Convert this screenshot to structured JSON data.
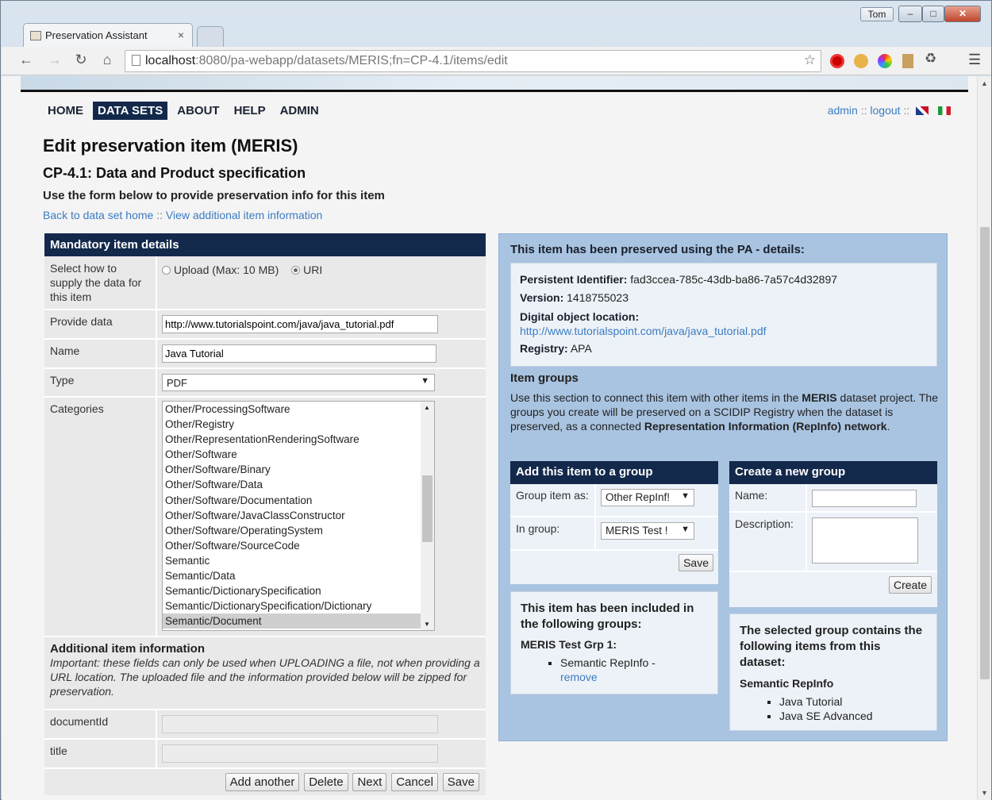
{
  "browser": {
    "tab_title": "Preservation Assistant",
    "url_host": "localhost",
    "url_rest": ":8080/pa-webapp/datasets/MERIS;fn=CP-4.1/items/edit",
    "user_badge": "Tom"
  },
  "nav": {
    "items": [
      "HOME",
      "DATA SETS",
      "ABOUT",
      "HELP",
      "ADMIN"
    ],
    "active": "DATA SETS",
    "admin_link": "admin",
    "logout_link": "logout",
    "sep": "::"
  },
  "page": {
    "title": "Edit preservation item (MERIS)",
    "subtitle": "CP-4.1: Data and Product specification",
    "instruction": "Use the form below to provide preservation info for this item",
    "back_link": "Back to data set home",
    "link_sep": "::",
    "view_link": "View additional item information"
  },
  "form": {
    "header": "Mandatory item details",
    "supply_label": "Select how to supply the data for this item",
    "upload_option": "Upload (Max: 10 MB)",
    "uri_option": "URI",
    "provide_label": "Provide data",
    "provide_value": "http://www.tutorialspoint.com/java/java_tutorial.pdf",
    "name_label": "Name",
    "name_value": "Java Tutorial",
    "type_label": "Type",
    "type_value": "PDF",
    "categories_label": "Categories",
    "categories": [
      "Other/ProcessingSoftware",
      "Other/Registry",
      "Other/RepresentationRenderingSoftware",
      "Other/Software",
      "Other/Software/Binary",
      "Other/Software/Data",
      "Other/Software/Documentation",
      "Other/Software/JavaClassConstructor",
      "Other/Software/OperatingSystem",
      "Other/Software/SourceCode",
      "Semantic",
      "Semantic/Data",
      "Semantic/DictionarySpecification",
      "Semantic/DictionarySpecification/Dictionary",
      "Semantic/Document"
    ],
    "selected_category": "Semantic/Document",
    "additional_title": "Additional item information",
    "additional_note": "Important: these fields can only be used when UPLOADING a file, not when providing a URL location. The uploaded file and the information provided below will be zipped for preservation.",
    "documentid_label": "documentId",
    "title_label": "title",
    "buttons": [
      "Add another",
      "Delete",
      "Next",
      "Cancel",
      "Save"
    ]
  },
  "preserved": {
    "header": "This item has been preserved using the PA - details:",
    "pid_label": "Persistent Identifier:",
    "pid_value": "fad3ccea-785c-43db-ba86-7a57c4d32897",
    "version_label": "Version:",
    "version_value": "1418755023",
    "location_label": "Digital object location:",
    "location_value": "http://www.tutorialspoint.com/java/java_tutorial.pdf",
    "registry_label": "Registry:",
    "registry_value": "APA"
  },
  "groups": {
    "title": "Item groups",
    "desc_a": "Use this section to connect this item with other items in the ",
    "desc_b": "MERIS",
    "desc_c": " dataset project. The groups you create will be preserved on a SCIDIP Registry when the dataset is preserved, as a connected ",
    "desc_d": "Representation Information (RepInfo) network",
    "desc_e": ".",
    "add_header": "Add this item to a group",
    "group_as_label": "Group item as:",
    "group_as_value": "Other RepInf!",
    "in_group_label": "In group:",
    "in_group_value": "MERIS Test !",
    "save_button": "Save",
    "create_header": "Create a new group",
    "name_label": "Name:",
    "description_label": "Description:",
    "create_button": "Create",
    "included_title": "This item has been included in the following groups:",
    "included_group": "MERIS Test Grp 1:",
    "included_item": "Semantic RepInfo -",
    "remove_link": "remove",
    "selected_title": "The selected group contains the following items from this dataset:",
    "selected_group": "Semantic RepInfo",
    "selected_items": [
      "Java Tutorial",
      "Java SE Advanced"
    ]
  },
  "colors": {
    "navy": "#13294b",
    "link": "#3b7cc1",
    "panel_blue": "#a9c4e1"
  }
}
